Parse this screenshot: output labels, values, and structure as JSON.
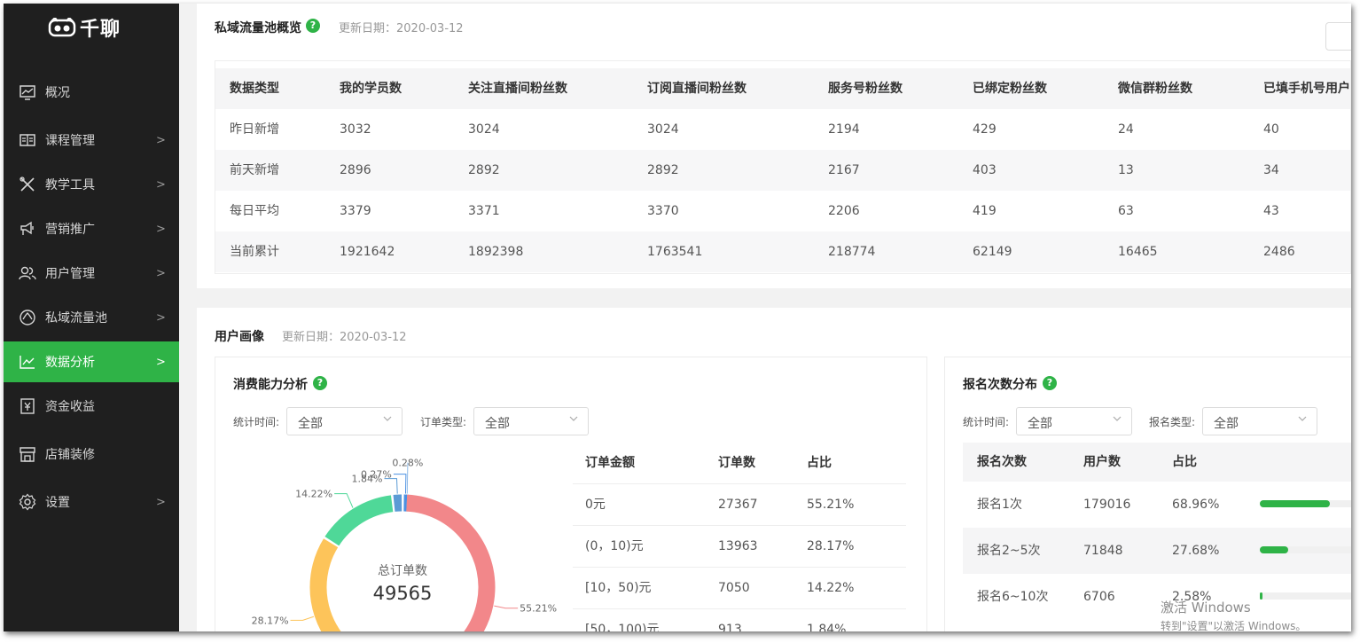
{
  "app": {
    "logo_text": "千聊"
  },
  "sidebar": {
    "items": [
      {
        "label": "概况",
        "arrow": ""
      },
      {
        "label": "课程管理",
        "arrow": ">"
      },
      {
        "label": "教学工具",
        "arrow": ">"
      },
      {
        "label": "营销推广",
        "arrow": ">"
      },
      {
        "label": "用户管理",
        "arrow": ">"
      },
      {
        "label": "私域流量池",
        "arrow": ">"
      },
      {
        "label": "数据分析",
        "arrow": ">"
      },
      {
        "label": "资金收益",
        "arrow": ""
      },
      {
        "label": "店铺装修",
        "arrow": ""
      },
      {
        "label": "设置",
        "arrow": ">"
      }
    ],
    "active": "数据分析"
  },
  "overview": {
    "title": "私域流量池概览",
    "help": "?",
    "update_date": "更新日期：2020-03-12",
    "columns": [
      "数据类型",
      "我的学员数",
      "关注直播间粉丝数",
      "订阅直播间粉丝数",
      "服务号粉丝数",
      "已绑定粉丝数",
      "微信群粉丝数",
      "已填手机号用户"
    ],
    "rows": [
      [
        "昨日新增",
        "3032",
        "3024",
        "3024",
        "2194",
        "429",
        "24",
        "40"
      ],
      [
        "前天新增",
        "2896",
        "2892",
        "2892",
        "2167",
        "403",
        "13",
        "34"
      ],
      [
        "每日平均",
        "3379",
        "3371",
        "3370",
        "2206",
        "419",
        "63",
        "43"
      ],
      [
        "当前累计",
        "1921642",
        "1892398",
        "1763541",
        "218774",
        "62149",
        "16465",
        "2486"
      ]
    ]
  },
  "portrait": {
    "title": "用户画像",
    "update_date": "更新日期：2020-03-12"
  },
  "consumption": {
    "title": "消费能力分析",
    "help": "?",
    "filter_time_label": "统计时间:",
    "filter_time_value": "全部",
    "filter_order_label": "订单类型:",
    "filter_order_value": "全部",
    "donut_center_label": "总订单数",
    "donut_center_value": "49565",
    "columns": [
      "订单金额",
      "订单数",
      "占比"
    ],
    "rows": [
      [
        "0元",
        "27367",
        "55.21%"
      ],
      [
        "(0，10)元",
        "13963",
        "28.17%"
      ],
      [
        "[10，50)元",
        "7050",
        "14.22%"
      ],
      [
        "[50，100)元",
        "913",
        "1.84%"
      ]
    ]
  },
  "chart_data": {
    "type": "pie",
    "categories": [
      "0元",
      "(0，10)元",
      "[10，50)元",
      "[50，100)元",
      "",
      ""
    ],
    "values": [
      55.21,
      28.17,
      14.22,
      1.84,
      0.27,
      0.28
    ],
    "labels": [
      "55.21%",
      "28.17%",
      "14.22%",
      "1.84%",
      "0.27%",
      "0.28%"
    ],
    "colors": [
      "#f2878a",
      "#fdc45a",
      "#4fd898",
      "#5b9bd5",
      "#4a90e2",
      "#8fb9e6"
    ]
  },
  "signup": {
    "title": "报名次数分布",
    "help": "?",
    "filter_time_label": "统计时间:",
    "filter_time_value": "全部",
    "filter_type_label": "报名类型:",
    "filter_type_value": "全部",
    "columns": [
      "报名次数",
      "用户数",
      "占比"
    ],
    "rows": [
      {
        "label": "报名1次",
        "users": "179016",
        "pct": "68.96%",
        "ratio": 0.6896
      },
      {
        "label": "报名2~5次",
        "users": "71848",
        "pct": "27.68%",
        "ratio": 0.2768
      },
      {
        "label": "报名6~10次",
        "users": "6706",
        "pct": "2.58%",
        "ratio": 0.0258
      }
    ]
  },
  "watermark": {
    "line1": "激活 Windows",
    "line2": "转到\"设置\"以激活 Windows。"
  }
}
